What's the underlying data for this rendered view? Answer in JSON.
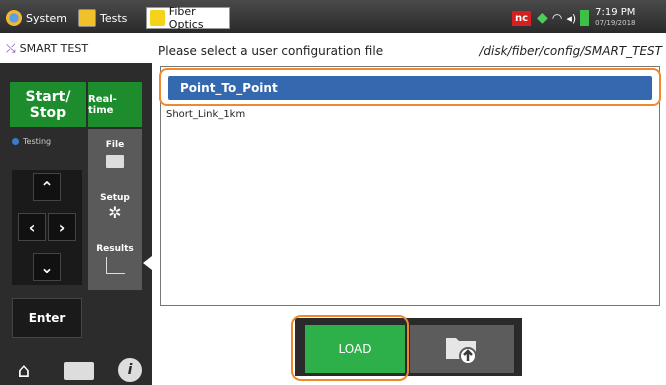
{
  "topbar": {
    "tabs": [
      {
        "label": "System"
      },
      {
        "label": "Tests"
      },
      {
        "label": "Fiber Optics"
      }
    ],
    "status": {
      "nc_badge": "nc",
      "time": "7:19 PM",
      "date": "07/19/2018"
    }
  },
  "sidebar": {
    "header": "SMART TEST",
    "start_stop_line1": "Start/",
    "start_stop_line2": "Stop",
    "realtime": "Real-time",
    "testing": "Testing",
    "file": "File",
    "setup": "Setup",
    "results": "Results",
    "enter": "Enter"
  },
  "main": {
    "prompt": "Please select a user configuration file",
    "path": "/disk/fiber/config/SMART_TEST",
    "files": [
      "Point_To_Point",
      "Short_Link_1km"
    ],
    "load_label": "LOAD"
  },
  "colors": {
    "accent_green": "#1c8c2c",
    "selection": "#3469b0",
    "highlight": "#f0892e"
  }
}
